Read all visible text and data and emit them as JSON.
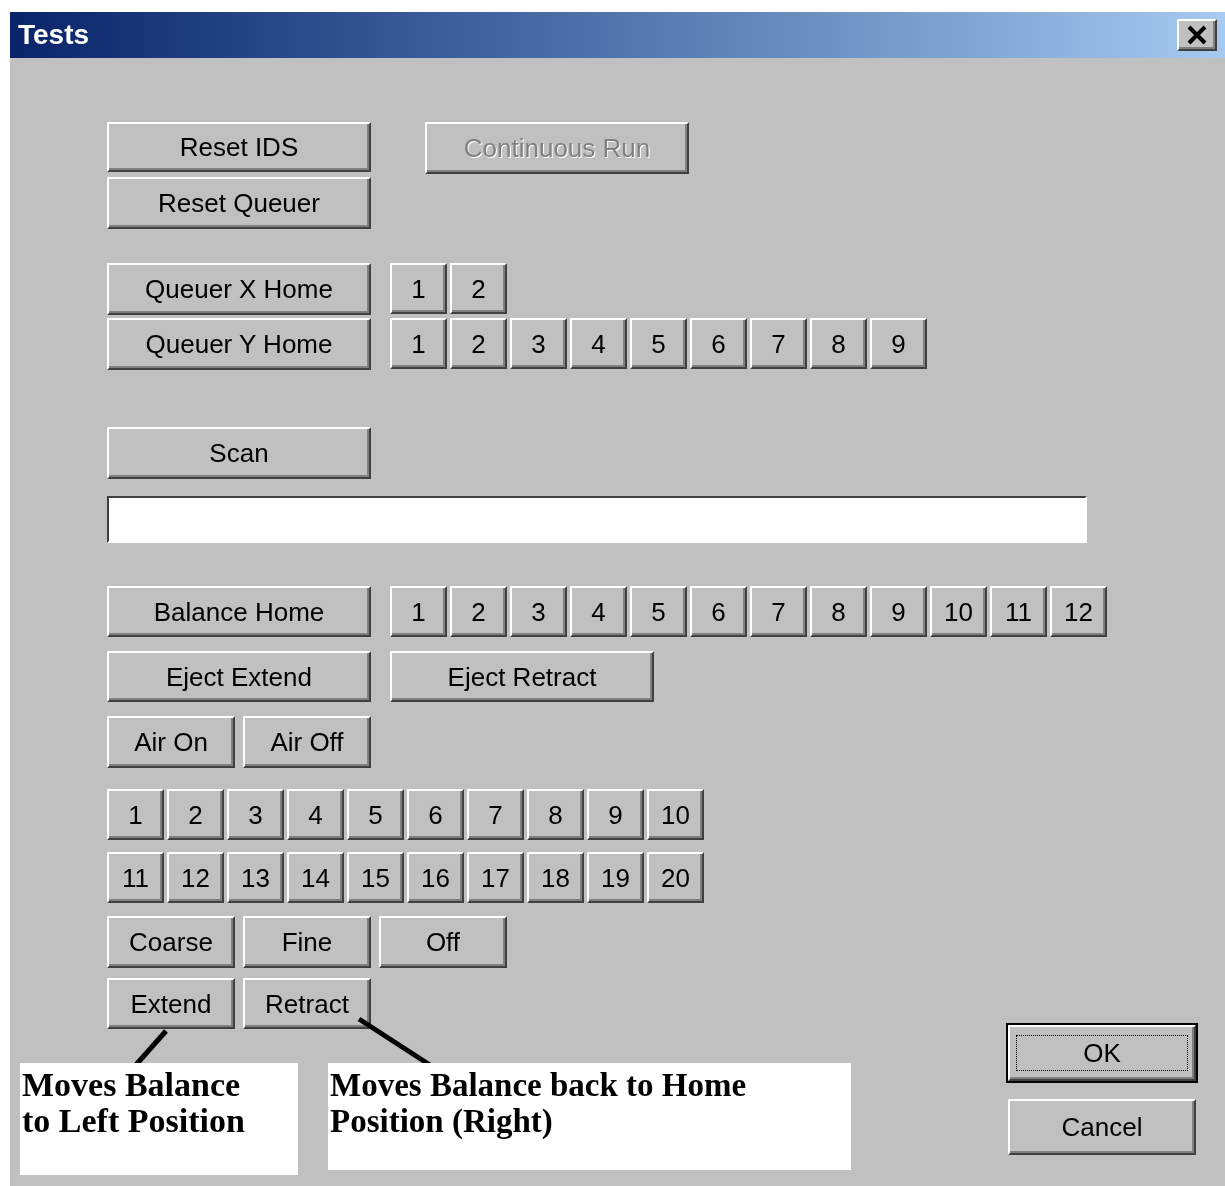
{
  "window": {
    "title": "Tests"
  },
  "top_buttons": [
    {
      "label": "Reset IDS",
      "disabled": false
    },
    {
      "label": "Continuous Run",
      "disabled": true
    },
    {
      "label": "Reset Queuer",
      "disabled": false
    }
  ],
  "queuer_x": {
    "label": "Queuer X Home",
    "numbers": [
      "1",
      "2"
    ]
  },
  "queuer_y": {
    "label": "Queuer Y Home",
    "numbers": [
      "1",
      "2",
      "3",
      "4",
      "5",
      "6",
      "7",
      "8",
      "9"
    ]
  },
  "scan": {
    "label": "Scan"
  },
  "balance": {
    "label": "Balance Home",
    "numbers": [
      "1",
      "2",
      "3",
      "4",
      "5",
      "6",
      "7",
      "8",
      "9",
      "10",
      "11",
      "12"
    ]
  },
  "eject": [
    "Eject Extend",
    "Eject Retract"
  ],
  "air": [
    "Air On",
    "Air Off"
  ],
  "number_rows": [
    [
      "1",
      "2",
      "3",
      "4",
      "5",
      "6",
      "7",
      "8",
      "9",
      "10"
    ],
    [
      "11",
      "12",
      "13",
      "14",
      "15",
      "16",
      "17",
      "18",
      "19",
      "20"
    ]
  ],
  "modes": [
    "Coarse",
    "Fine",
    "Off"
  ],
  "actions": [
    "Extend",
    "Retract"
  ],
  "dialog_buttons": [
    {
      "label": "OK",
      "default": true
    },
    {
      "label": "Cancel",
      "default": false
    }
  ],
  "annotations": [
    "Moves Balance to Left Position",
    "Moves Balance back to Home Position (Right)"
  ]
}
